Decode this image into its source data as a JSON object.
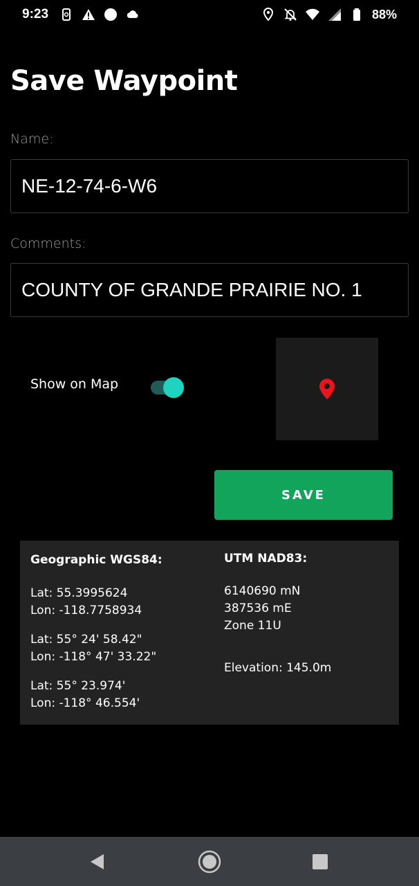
{
  "status_bar": {
    "time": "9:23",
    "battery": "88%",
    "left_icons": [
      "phone-sync-icon",
      "warning-icon",
      "circle-icon",
      "cloud-icon"
    ],
    "right_icons": [
      "location-icon",
      "bell-off-icon",
      "wifi-icon",
      "signal-icon",
      "battery-icon"
    ]
  },
  "page": {
    "title": "Save Waypoint"
  },
  "form": {
    "name_label": "Name:",
    "name_value": "NE-12-74-6-W6",
    "comments_label": "Comments:",
    "comments_value": "COUNTY OF GRANDE PRAIRIE NO. 1",
    "show_on_map_label": "Show on Map",
    "show_on_map_enabled": true,
    "save_label": "SAVE"
  },
  "geographic": {
    "heading": "Geographic WGS84:",
    "decimal_lat": "Lat: 55.3995624",
    "decimal_lon": "Lon: -118.7758934",
    "dms_lat": "Lat: 55° 24' 58.42\"",
    "dms_lon": "Lon: -118° 47' 33.22\"",
    "dm_lat": "Lat: 55° 23.974'",
    "dm_lon": "Lon: -118° 46.554'"
  },
  "utm": {
    "heading": "UTM NAD83:",
    "northing": "6140690 mN",
    "easting": "387536 mE",
    "zone": "Zone 11U",
    "elevation": "Elevation: 145.0m"
  },
  "colors": {
    "accent": "#13a45b",
    "toggle_on": "#1ed3c0",
    "pin": "#e8151b",
    "panel": "#232323"
  },
  "nav_bar": {
    "icons": [
      "back-icon",
      "home-icon",
      "recents-icon"
    ]
  }
}
